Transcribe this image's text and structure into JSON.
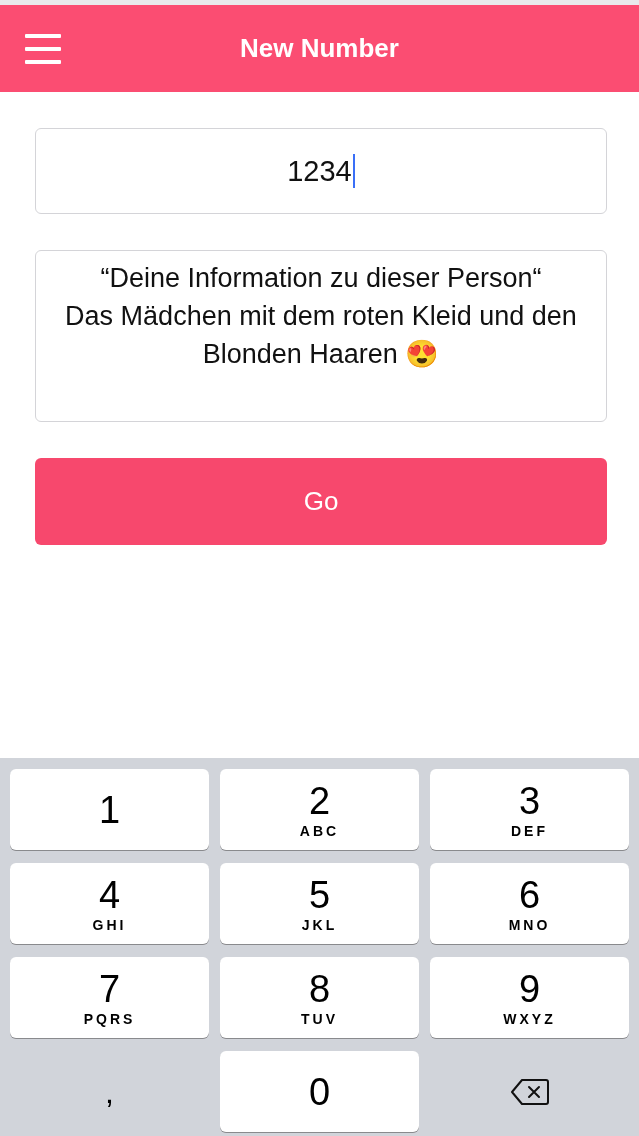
{
  "header": {
    "title": "New Number"
  },
  "number_field": {
    "value": "1234",
    "focused": true
  },
  "info_field": {
    "value": "“Deine Information zu dieser Person“\nDas Mädchen mit dem roten Kleid und den Blonden Haaren 😍"
  },
  "go_button": {
    "label": "Go"
  },
  "keypad": [
    {
      "kind": "key",
      "digit": "1"
    },
    {
      "kind": "key",
      "digit": "2",
      "letters": "ABC"
    },
    {
      "kind": "key",
      "digit": "3",
      "letters": "DEF"
    },
    {
      "kind": "key",
      "digit": "4",
      "letters": "GHI"
    },
    {
      "kind": "key",
      "digit": "5",
      "letters": "JKL"
    },
    {
      "kind": "key",
      "digit": "6",
      "letters": "MNO"
    },
    {
      "kind": "key",
      "digit": "7",
      "letters": "PQRS"
    },
    {
      "kind": "key",
      "digit": "8",
      "letters": "TUV"
    },
    {
      "kind": "key",
      "digit": "9",
      "letters": "WXYZ"
    },
    {
      "kind": "plain",
      "digit": ","
    },
    {
      "kind": "key",
      "digit": "0"
    },
    {
      "kind": "delete"
    }
  ]
}
